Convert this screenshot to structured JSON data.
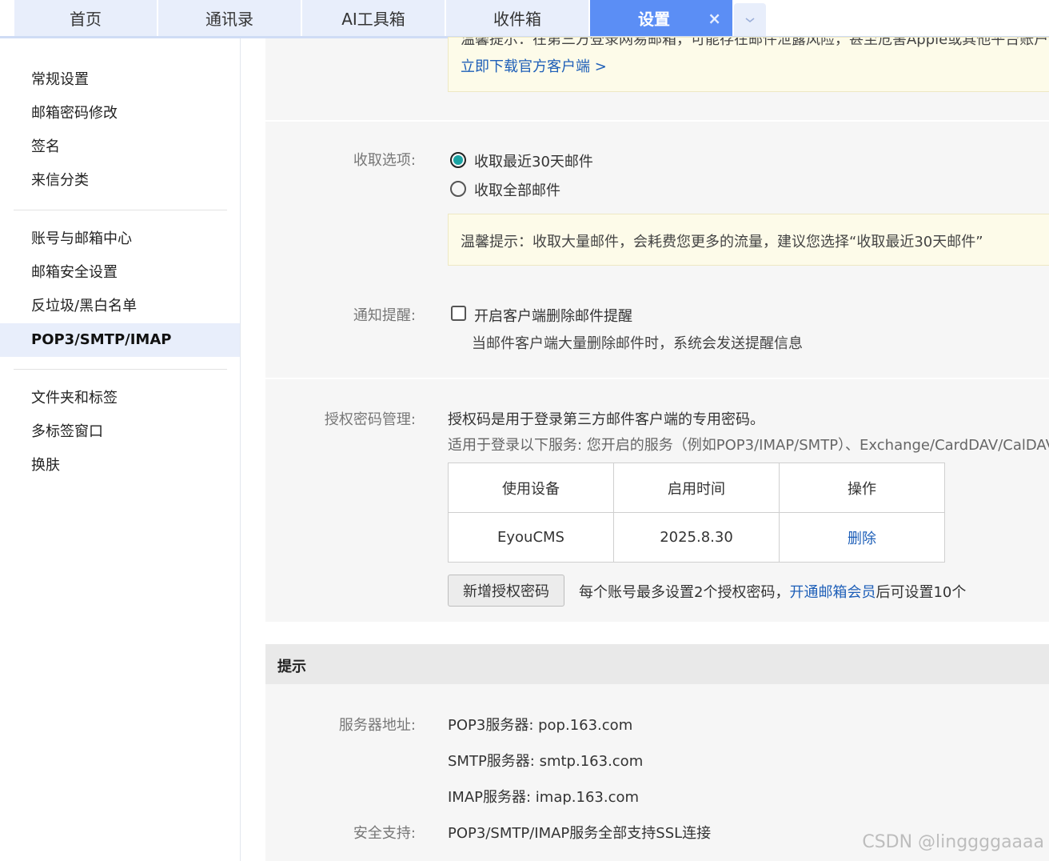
{
  "tabs": [
    {
      "label": "首页"
    },
    {
      "label": "通讯录"
    },
    {
      "label": "AI工具箱"
    },
    {
      "label": "收件箱"
    },
    {
      "label": "设置"
    }
  ],
  "tab_close": "×",
  "tab_more_glyph": "⌄",
  "sidebar": {
    "groups": [
      [
        "常规设置",
        "邮箱密码修改",
        "签名",
        "来信分类"
      ],
      [
        "账号与邮箱中心",
        "邮箱安全设置",
        "反垃圾/黑白名单",
        "POP3/SMTP/IMAP"
      ],
      [
        "文件夹和标签",
        "多标签窗口",
        "换肤"
      ]
    ],
    "active": "POP3/SMTP/IMAP"
  },
  "top_notice": {
    "cut_text": "温馨提示：在第三方登录网易邮箱，可能存在邮件泄露风险，甚至危害Apple或其他平台账户，",
    "link": "立即下载官方客户端 >"
  },
  "receive": {
    "label": "收取选项:",
    "options": [
      "收取最近30天邮件",
      "收取全部邮件"
    ],
    "selected": "收取最近30天邮件",
    "tip": "温馨提示：收取大量邮件，会耗费您更多的流量，建议您选择“收取最近30天邮件”"
  },
  "notify": {
    "label": "通知提醒:",
    "checkbox_label": "开启客户端删除邮件提醒",
    "checked": false,
    "desc": "当邮件客户端大量删除邮件时，系统会发送提醒信息"
  },
  "auth": {
    "label": "授权密码管理:",
    "intro": "授权码是用于登录第三方邮件客户端的专用密码。",
    "scope": "适用于登录以下服务: 您开启的服务（例如POP3/IMAP/SMTP）、Exchange/CardDAV/CalDAV服务",
    "table": {
      "headers": [
        "使用设备",
        "启用时间",
        "操作"
      ],
      "rows": [
        [
          "EyouCMS",
          "2025.8.30",
          "删除"
        ]
      ]
    },
    "add_button": "新增授权密码",
    "limit_text": "每个账号最多设置2个授权密码，",
    "vip_link": "开通邮箱会员",
    "limit_suffix": "后可设置10个"
  },
  "tips_section": {
    "title": "提示",
    "server_label": "服务器地址:",
    "servers": [
      "POP3服务器: pop.163.com",
      "SMTP服务器: smtp.163.com",
      "IMAP服务器: imap.163.com"
    ],
    "security_label": "安全支持:",
    "security_text": "POP3/SMTP/IMAP服务全部支持SSL连接"
  },
  "watermark": "CSDN @linggggaaaa",
  "colors": {
    "tab_active": "#5b8ef5",
    "tab_inactive": "#e8eefb",
    "link": "#1e5fb8",
    "radio_fill": "#1aa3a3",
    "notice_bg": "#fdfbe9"
  }
}
